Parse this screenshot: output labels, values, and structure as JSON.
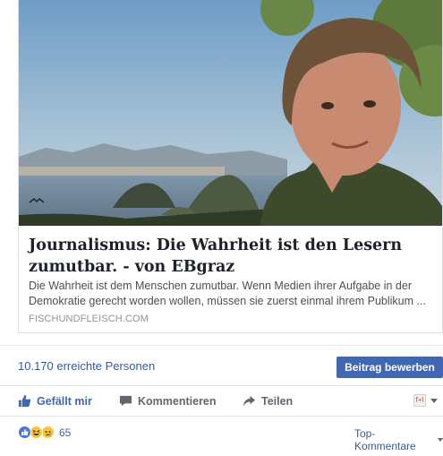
{
  "link_card": {
    "title": "Journalismus: Die Wahrheit ist den Lesern zumutbar. - von EBgraz",
    "description": "Die Wahrheit ist dem Menschen zumutbar. Wenn Medien ihrer Aufgabe in der Demokratie gerecht worden wollen, müssen sie zuerst einmal ihrem Publikum ...",
    "domain": "FISCHUNDFLEISCH.COM"
  },
  "stats": {
    "reach": "10.170 erreichte Personen",
    "boost_label": "Beitrag bewerben"
  },
  "actions": {
    "like": "Gefällt mir",
    "comment": "Kommentieren",
    "share": "Teilen"
  },
  "reactions": {
    "count": "65",
    "types": [
      "like",
      "haha",
      "sad"
    ]
  },
  "comments": {
    "sort_label": "Top-Kommentare"
  },
  "colors": {
    "accent": "#4267b2",
    "link": "#365899"
  }
}
